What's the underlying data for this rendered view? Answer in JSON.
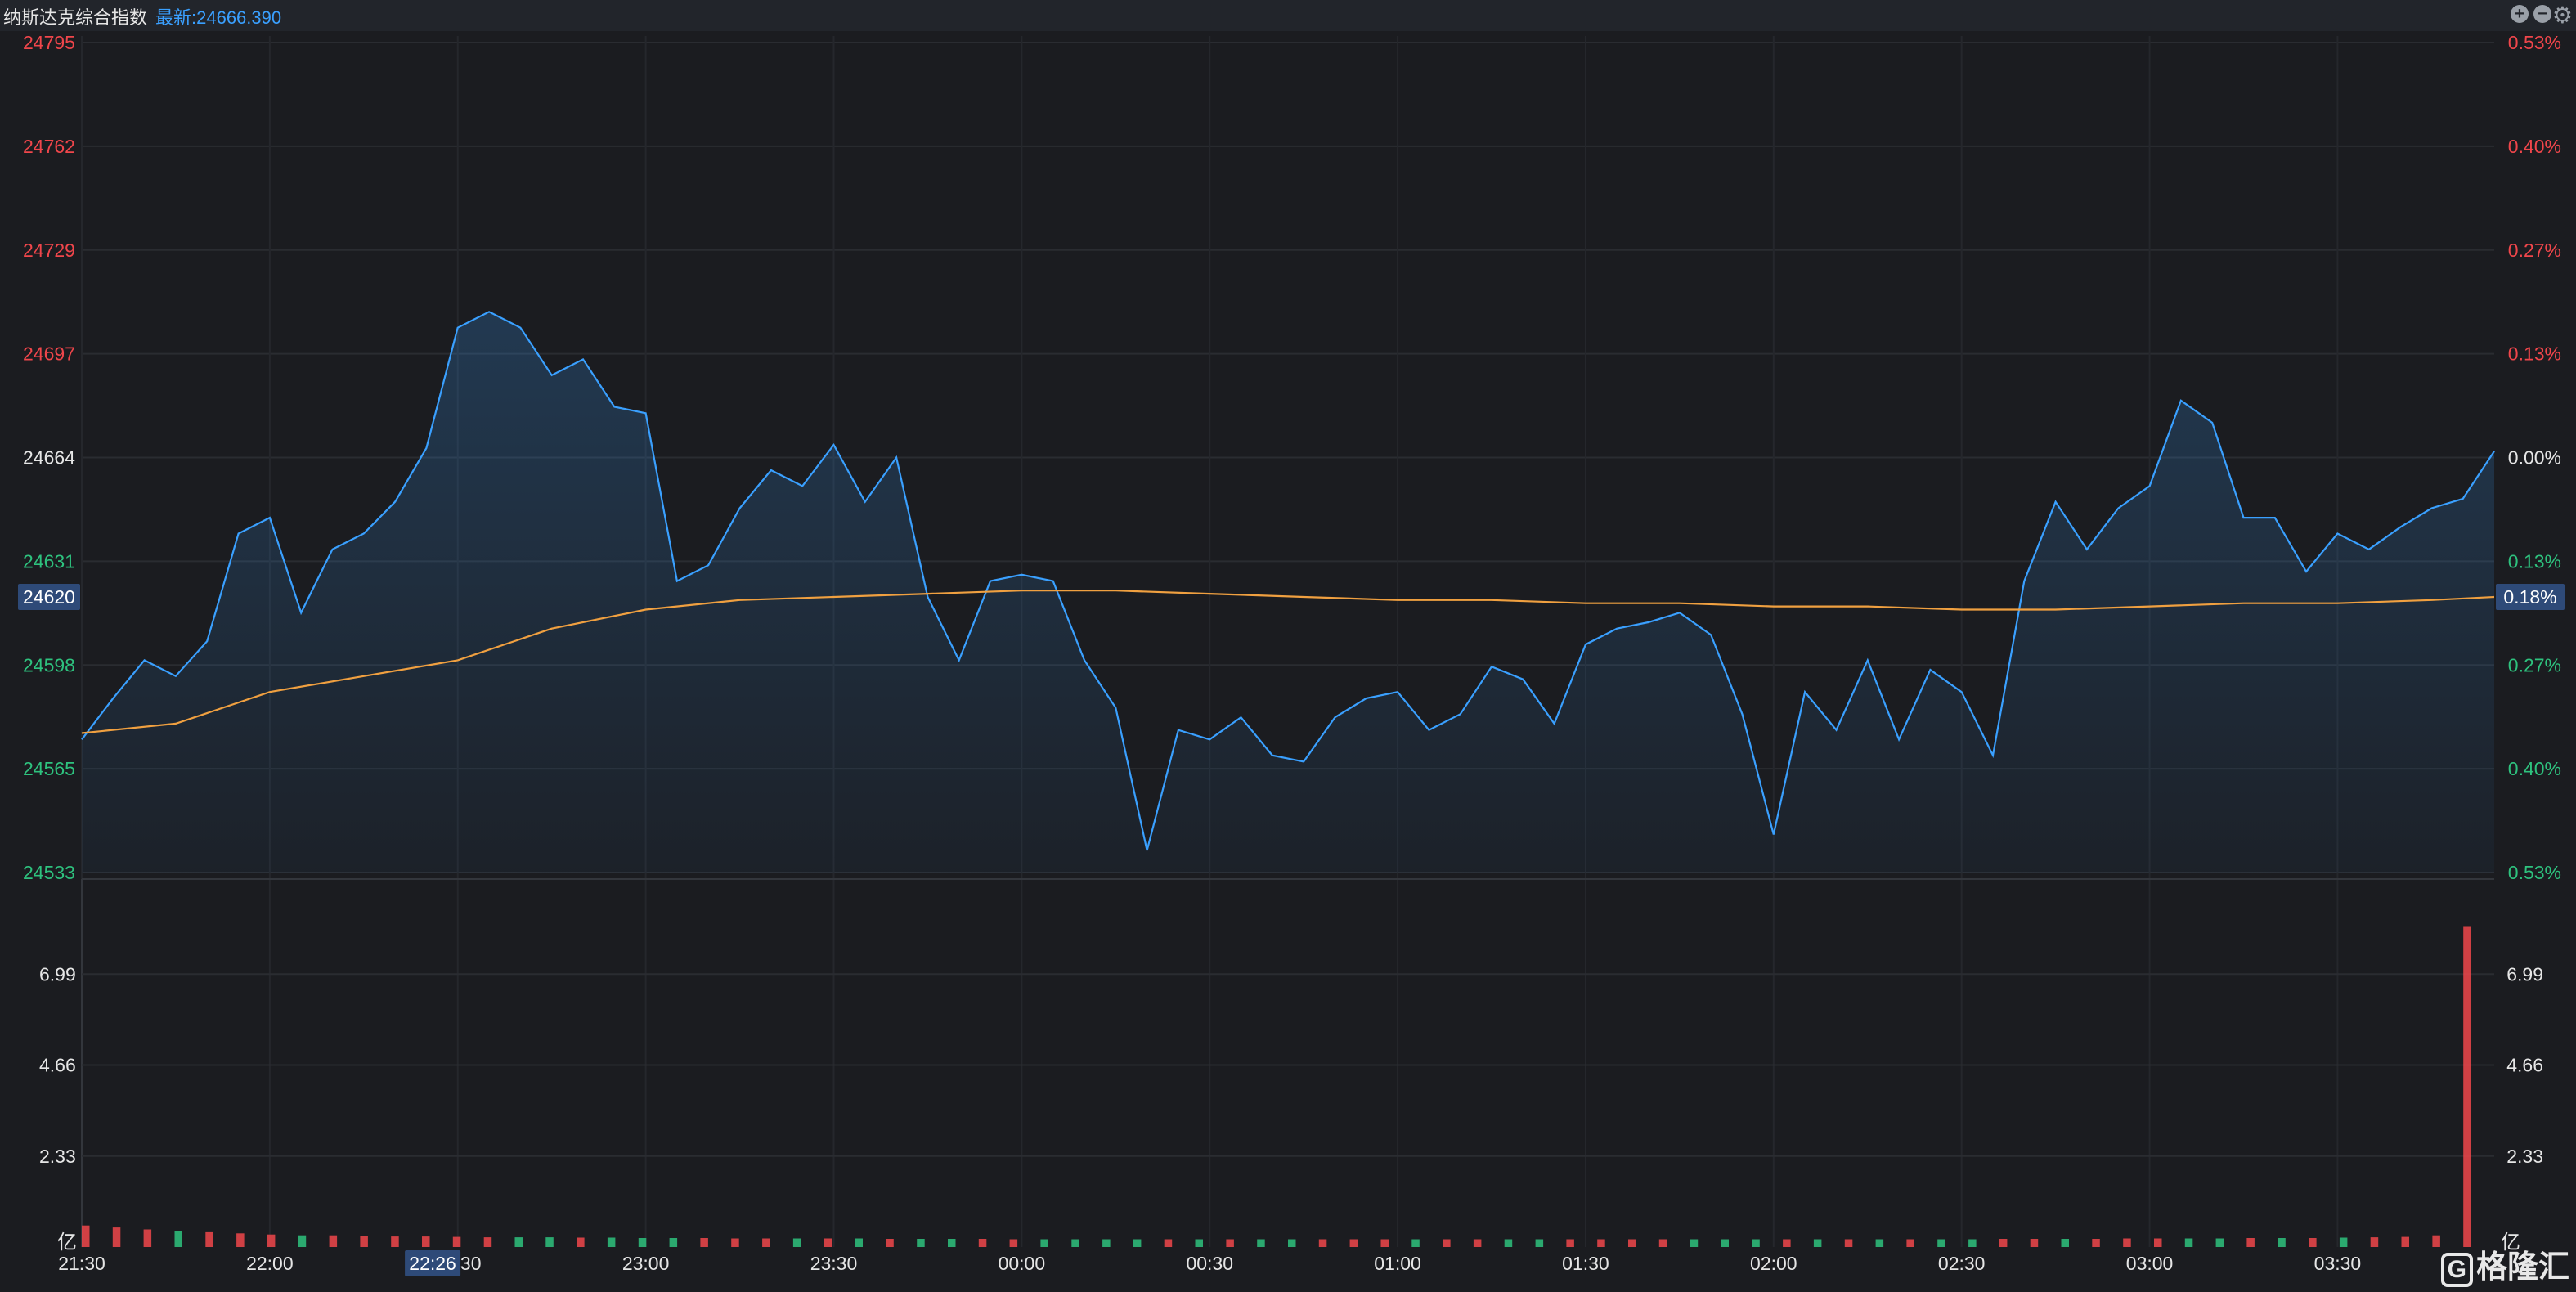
{
  "header": {
    "title": "纳斯达克综合指数",
    "latest": "最新:24666.390",
    "zoom_in_icon": "plus-circle-icon",
    "zoom_out_icon": "minus-circle-icon",
    "settings_icon": "gear-icon"
  },
  "colors": {
    "background": "#1b1c20",
    "price_line": "#3aa0ff",
    "avg_line": "#f0a040",
    "up": "#f0464b",
    "down": "#2ec27e",
    "neutral": "#e6e6e6",
    "crosshair_label_bg": "#2e4a78"
  },
  "brand": {
    "icon": "G",
    "text": "格隆汇"
  },
  "chart_data": {
    "type": "line",
    "series": [
      {
        "name": "price",
        "x": [
          "21:30",
          "21:35",
          "21:40",
          "21:45",
          "21:50",
          "21:55",
          "22:00",
          "22:05",
          "22:10",
          "22:15",
          "22:20",
          "22:25",
          "22:30",
          "22:35",
          "22:40",
          "22:45",
          "22:50",
          "22:55",
          "23:00",
          "23:05",
          "23:10",
          "23:15",
          "23:20",
          "23:25",
          "23:30",
          "23:35",
          "23:40",
          "23:45",
          "23:50",
          "23:55",
          "00:00",
          "00:05",
          "00:10",
          "00:15",
          "00:20",
          "00:25",
          "00:30",
          "00:35",
          "00:40",
          "00:45",
          "00:50",
          "00:55",
          "01:00",
          "01:05",
          "01:10",
          "01:15",
          "01:20",
          "01:25",
          "01:30",
          "01:35",
          "01:40",
          "01:45",
          "01:50",
          "01:55",
          "02:00",
          "02:05",
          "02:10",
          "02:15",
          "02:20",
          "02:25",
          "02:30",
          "02:35",
          "02:40",
          "02:45",
          "02:50",
          "02:55",
          "03:00",
          "03:05",
          "03:10",
          "03:15",
          "03:20",
          "03:25",
          "03:30",
          "03:35",
          "03:40",
          "03:45",
          "03:50",
          "03:55"
        ],
        "y": [
          24575,
          24588,
          24600,
          24595,
          24606,
          24640,
          24645,
          24615,
          24635,
          24640,
          24650,
          24667,
          24705,
          24710,
          24705,
          24690,
          24695,
          24680,
          24678,
          24625,
          24630,
          24648,
          24660,
          24655,
          24668,
          24650,
          24664,
          24620,
          24600,
          24625,
          24627,
          24625,
          24600,
          24585,
          24540,
          24578,
          24575,
          24582,
          24570,
          24568,
          24582,
          24588,
          24590,
          24578,
          24583,
          24598,
          24594,
          24580,
          24605,
          24610,
          24612,
          24615,
          24608,
          24583,
          24545,
          24590,
          24578,
          24600,
          24575,
          24597,
          24590,
          24570,
          24625,
          24650,
          24635,
          24648,
          24655,
          24682,
          24675,
          24645,
          24645,
          24628,
          24640,
          24635,
          24642,
          24648,
          24651,
          24666
        ]
      },
      {
        "name": "avg",
        "x": [
          "21:30",
          "21:45",
          "22:00",
          "22:15",
          "22:30",
          "22:45",
          "23:00",
          "23:15",
          "23:30",
          "23:45",
          "00:00",
          "00:15",
          "00:30",
          "00:45",
          "01:00",
          "01:15",
          "01:30",
          "01:45",
          "02:00",
          "02:15",
          "02:30",
          "02:45",
          "03:00",
          "03:15",
          "03:30",
          "03:45",
          "03:55"
        ],
        "y": [
          24577,
          24580,
          24590,
          24595,
          24600,
          24610,
          24616,
          24619,
          24620,
          24621,
          24622,
          24622,
          24621,
          24620,
          24619,
          24619,
          24618,
          24618,
          24617,
          24617,
          24616,
          24616,
          24617,
          24618,
          24618,
          24619,
          24620
        ]
      }
    ],
    "y_ticks_left": [
      "24795",
      "24762",
      "24729",
      "24697",
      "24664",
      "24631",
      "24598",
      "24565",
      "24533"
    ],
    "y_ticks_right": [
      "0.53%",
      "0.40%",
      "0.27%",
      "0.13%",
      "0.00%",
      "0.13%",
      "0.27%",
      "0.40%",
      "0.53%"
    ],
    "ylim": [
      24533,
      24795
    ],
    "base_price": 24664,
    "x_ticks": [
      "21:30",
      "22:00",
      "22:30",
      "23:00",
      "23:30",
      "00:00",
      "00:30",
      "01:00",
      "01:30",
      "02:00",
      "02:30",
      "03:00",
      "03:30"
    ],
    "crosshair": {
      "price": "24620",
      "percent": "0.18%",
      "time": "22:26"
    },
    "volume": {
      "unit": "亿",
      "ticks": [
        "6.99",
        "4.66",
        "2.33"
      ],
      "ylim": [
        0,
        9.32
      ],
      "values": [
        0.55,
        0.5,
        0.45,
        0.4,
        0.38,
        0.35,
        0.32,
        0.3,
        0.3,
        0.28,
        0.27,
        0.27,
        0.26,
        0.25,
        0.25,
        0.25,
        0.24,
        0.24,
        0.23,
        0.23,
        0.23,
        0.22,
        0.22,
        0.22,
        0.22,
        0.22,
        0.21,
        0.21,
        0.21,
        0.21,
        0.2,
        0.2,
        0.2,
        0.2,
        0.2,
        0.2,
        0.2,
        0.2,
        0.2,
        0.2,
        0.2,
        0.2,
        0.2,
        0.2,
        0.2,
        0.2,
        0.2,
        0.2,
        0.2,
        0.2,
        0.2,
        0.2,
        0.2,
        0.2,
        0.2,
        0.2,
        0.2,
        0.2,
        0.2,
        0.2,
        0.2,
        0.2,
        0.21,
        0.21,
        0.21,
        0.21,
        0.22,
        0.22,
        0.22,
        0.22,
        0.23,
        0.23,
        0.23,
        0.24,
        0.25,
        0.26,
        0.3,
        8.2
      ],
      "last_marker": 8.2
    }
  }
}
